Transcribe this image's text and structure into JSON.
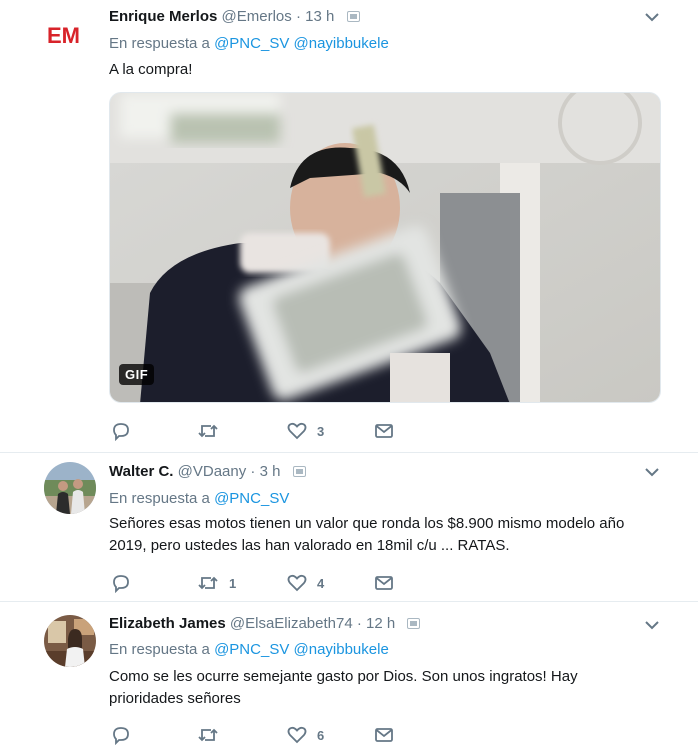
{
  "tweets": [
    {
      "name": "Enrique Merlos",
      "handle": "@Emerlos",
      "dot": "·",
      "time": "13 h",
      "reply_prefix": "En respuesta a",
      "mentions": [
        "@PNC_SV",
        "@nayibbukele"
      ],
      "avatar_logo_text": "EM",
      "text": "A la compra!",
      "media": {
        "type": "gif",
        "badge": "GIF"
      },
      "reply_count": "",
      "retweet_count": "",
      "like_count": "3"
    },
    {
      "name": "Walter C.",
      "handle": "@VDaany",
      "dot": "·",
      "time": "3 h",
      "reply_prefix": "En respuesta a",
      "mentions": [
        "@PNC_SV"
      ],
      "text": "Señores esas motos tienen un valor que ronda los $8.900 mismo modelo año 2019, pero ustedes las han valorado en 18mil c/u ... RATAS.",
      "reply_count": "",
      "retweet_count": "1",
      "like_count": "4"
    },
    {
      "name": "Elizabeth James",
      "handle": "@ElsaElizabeth74",
      "dot": "·",
      "time": "12 h",
      "reply_prefix": "En respuesta a",
      "mentions": [
        "@PNC_SV",
        "@nayibbukele"
      ],
      "text": "Como se les ocurre semejante gasto por Dios.  Son unos ingratos! Hay prioridades señores",
      "reply_count": "",
      "retweet_count": "",
      "like_count": "6"
    }
  ],
  "colors": {
    "link": "#1b95e0",
    "secondary": "#657786",
    "brand_logo_red": "#d8232a",
    "divider": "#e6ecf0"
  }
}
